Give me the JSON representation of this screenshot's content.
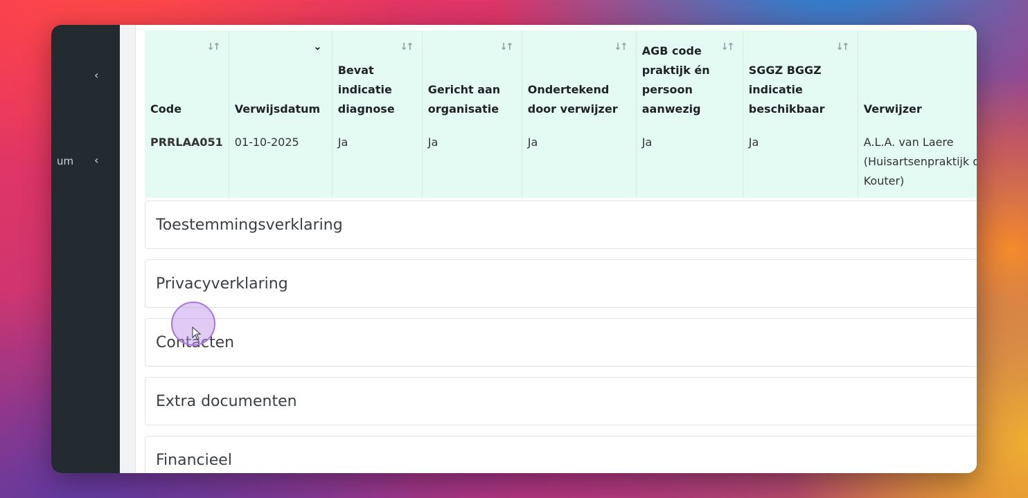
{
  "sidebar": {
    "partial_label": "um"
  },
  "table": {
    "columns": [
      {
        "label": "Code",
        "sort": "sortable"
      },
      {
        "label": "Verwijsdatum",
        "sort": "desc"
      },
      {
        "label": "Bevat indicatie diagnose",
        "sort": "sortable"
      },
      {
        "label": "Gericht aan organisatie",
        "sort": "sortable"
      },
      {
        "label": "Ondertekend door verwijzer",
        "sort": "sortable"
      },
      {
        "label": "AGB code praktijk én persoon aanwezig",
        "sort": "sortable"
      },
      {
        "label": "SGGZ BGGZ indicatie beschikbaar",
        "sort": "sortable"
      },
      {
        "label": "Verwijzer",
        "sort": "none"
      }
    ],
    "rows": [
      {
        "code": "PRRLAA051",
        "verwijsdatum": "01-10-2025",
        "indicatie": "Ja",
        "organisatie": "Ja",
        "ondertekend": "Ja",
        "agb": "Ja",
        "sggz": "Ja",
        "verwijzer": "A.L.A. van Laere (Huisartsenpraktijk de Kouter)"
      }
    ]
  },
  "sections": [
    {
      "label": "Toestemmingsverklaring"
    },
    {
      "label": "Privacyverklaring"
    },
    {
      "label": "Contacten"
    },
    {
      "label": "Extra documenten"
    },
    {
      "label": "Financieel"
    }
  ],
  "icons": {
    "sort": "sort-arrows-icon",
    "sort_active": "chevron-down-icon",
    "collapse": "chevron-left-icon"
  }
}
